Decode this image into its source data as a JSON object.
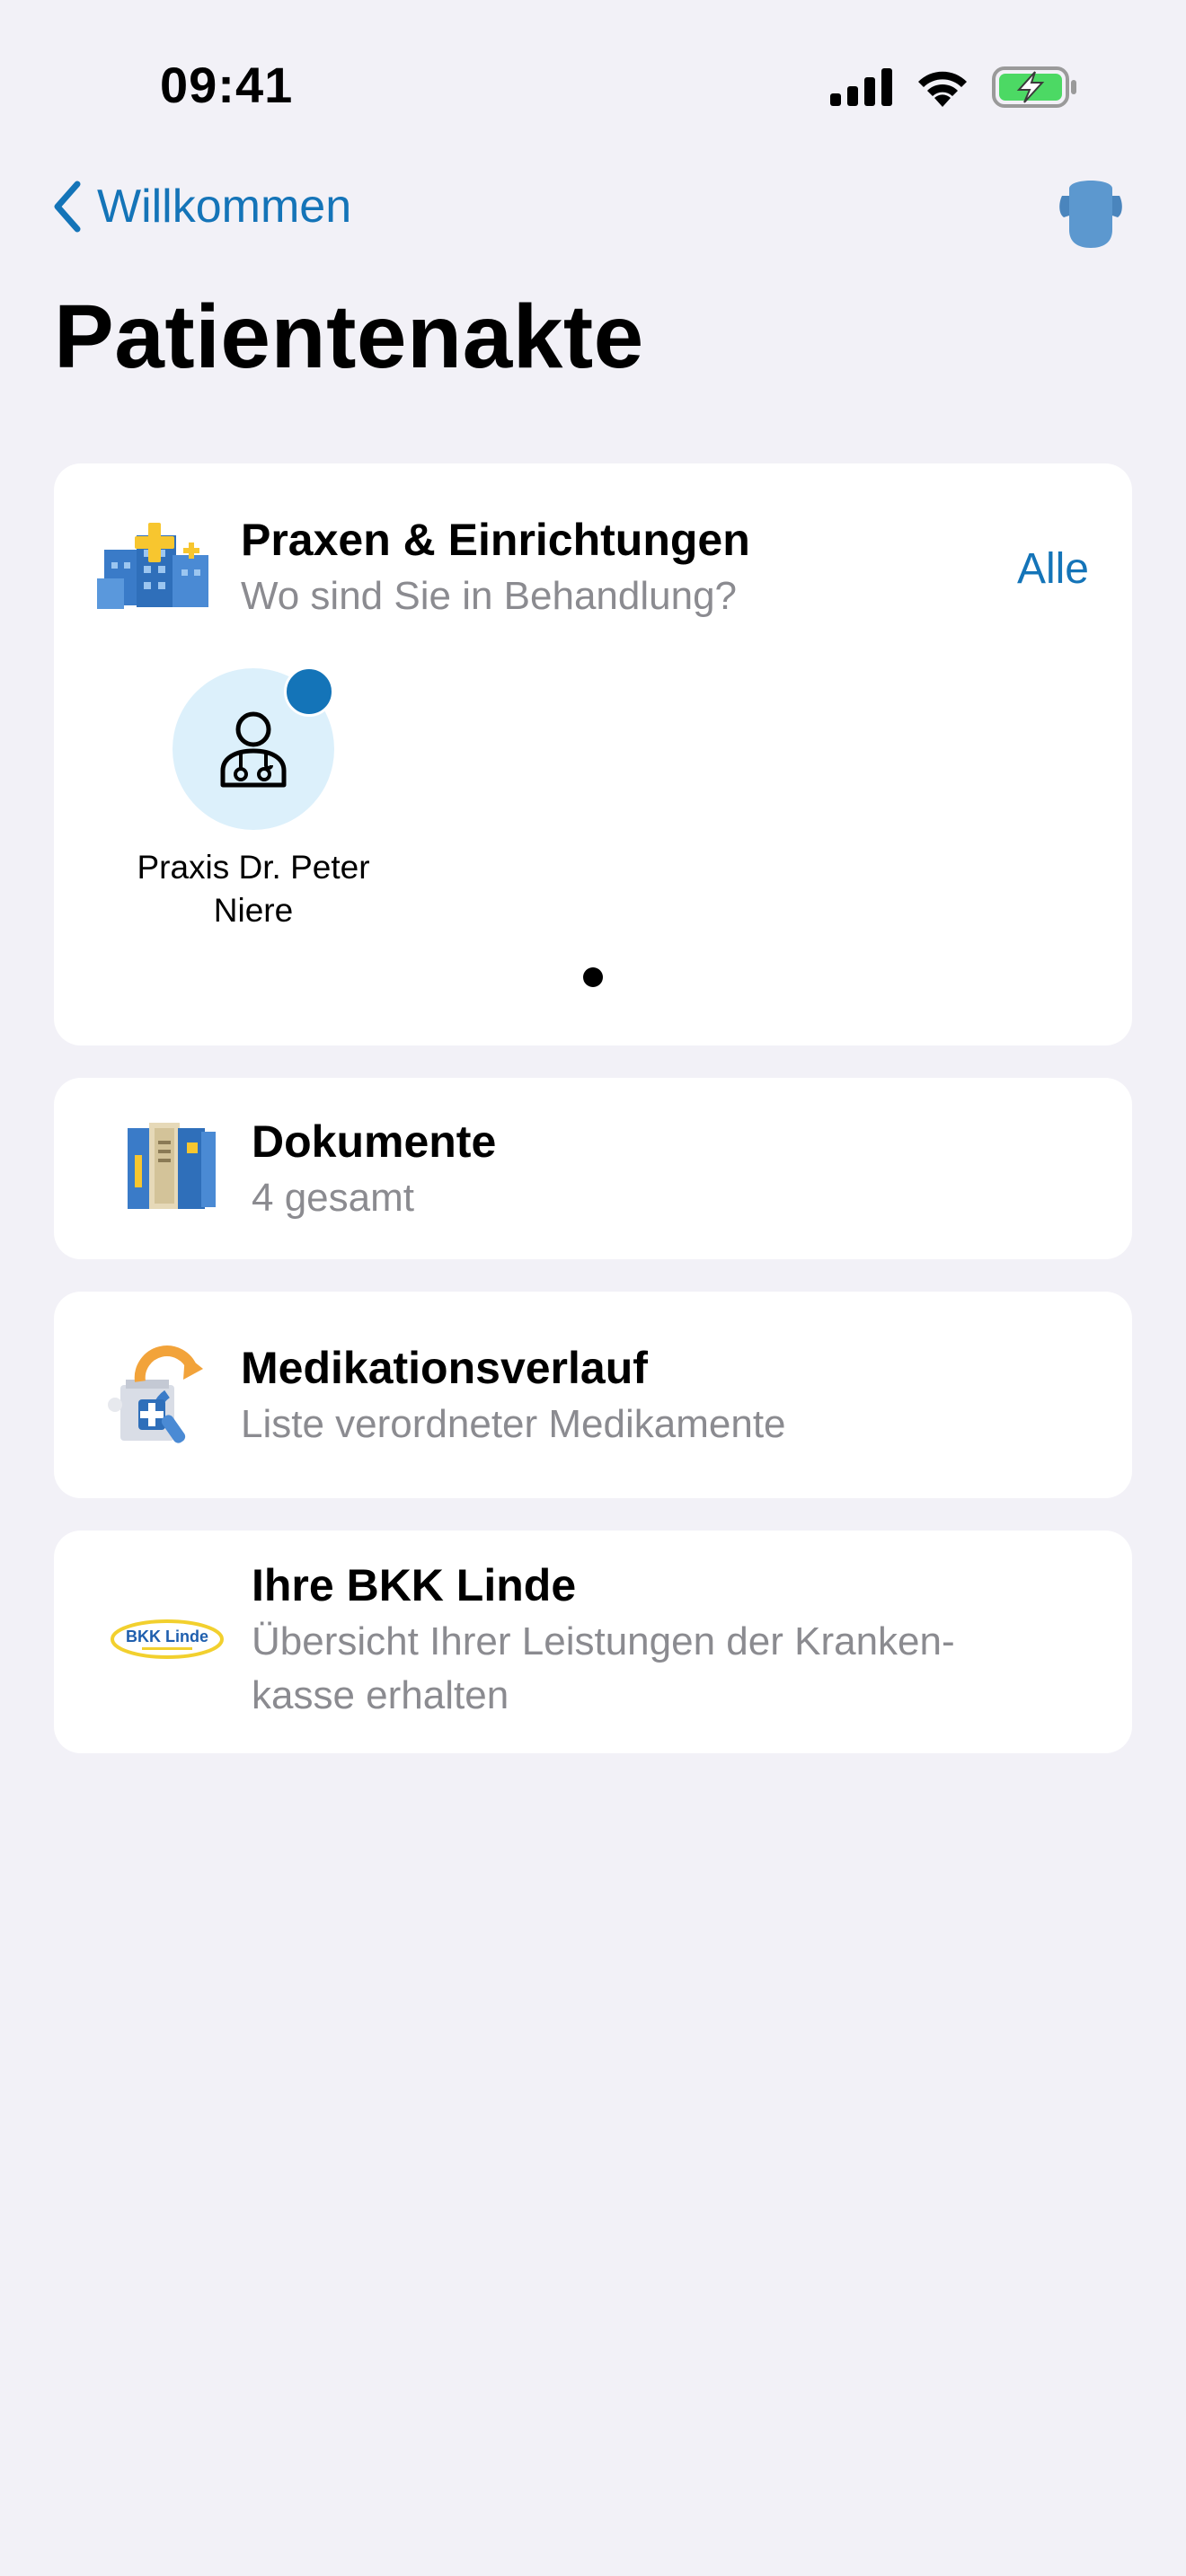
{
  "status_bar": {
    "time": "09:41"
  },
  "nav": {
    "back_label": "Willkommen"
  },
  "page": {
    "title": "Patientenakte"
  },
  "facilities": {
    "title": "Praxen & Einrichtungen",
    "subtitle": "Wo sind Sie in Behandlung?",
    "all_label": "Alle",
    "items": [
      {
        "name_line1": "Praxis Dr. Peter",
        "name_line2": "Niere"
      }
    ]
  },
  "documents": {
    "title": "Dokumente",
    "subtitle": "4 gesamt"
  },
  "medication": {
    "title": "Medikationsverlauf",
    "subtitle": "Liste verordneter Medikamente"
  },
  "insurance": {
    "title": "Ihre BKK Linde",
    "subtitle_line1": "Übersicht Ihrer Leistungen der Kranken-",
    "subtitle_line2": "kasse erhalten",
    "logo_text": "BKK Linde"
  },
  "colors": {
    "accent": "#1474b8",
    "background": "#f2f1f7",
    "secondary_text": "#8b8b90"
  }
}
